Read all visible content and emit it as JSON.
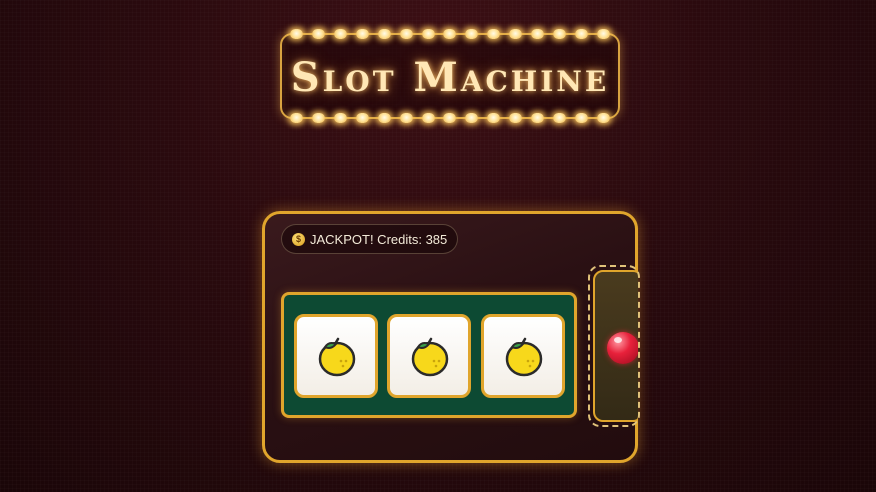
{
  "title": "Slot Machine",
  "status": {
    "icon": "money-bag-icon",
    "text": "JACKPOT! Credits: 385"
  },
  "reels": [
    {
      "symbol": "lemon"
    },
    {
      "symbol": "lemon"
    },
    {
      "symbol": "lemon"
    }
  ],
  "lever": {
    "icon": "red-ball-knob"
  },
  "colors": {
    "accent_gold": "#e0a52c",
    "background": "#2a0a0e",
    "reel_felt": "#0d4a33",
    "knob_red": "#e8213b"
  }
}
